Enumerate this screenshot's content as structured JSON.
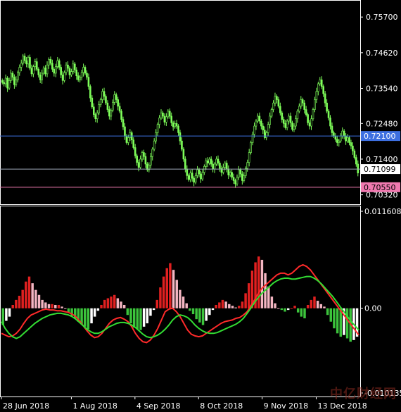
{
  "chart_data": [
    {
      "type": "candlestick",
      "panel": "price",
      "y_ticks": [
        "0.75700",
        "0.74620",
        "0.73540",
        "0.72480",
        "0.71400",
        "0.70320"
      ],
      "ylim": [
        0.7012,
        0.7596
      ],
      "closes": [
        0.7372,
        0.7368,
        0.7385,
        0.7355,
        0.7378,
        0.74,
        0.7388,
        0.7365,
        0.738,
        0.7402,
        0.7418,
        0.743,
        0.7452,
        0.7438,
        0.7428,
        0.7448,
        0.7415,
        0.7398,
        0.742,
        0.7435,
        0.7412,
        0.7395,
        0.738,
        0.74,
        0.7416,
        0.7398,
        0.7425,
        0.7442,
        0.743,
        0.7412,
        0.74,
        0.742,
        0.7438,
        0.7418,
        0.7395,
        0.7378,
        0.7402,
        0.7425,
        0.7415,
        0.7395,
        0.7405,
        0.7428,
        0.741,
        0.7392,
        0.738,
        0.7388,
        0.7402,
        0.7418,
        0.74,
        0.7388,
        0.736,
        0.7325,
        0.7298,
        0.7275,
        0.7262,
        0.728,
        0.7305,
        0.732,
        0.7345,
        0.733,
        0.731,
        0.729,
        0.727,
        0.7288,
        0.7312,
        0.7335,
        0.732,
        0.73,
        0.7285,
        0.726,
        0.7238,
        0.721,
        0.719,
        0.7205,
        0.722,
        0.7198,
        0.7175,
        0.715,
        0.713,
        0.7115,
        0.714,
        0.716,
        0.7148,
        0.7125,
        0.7108,
        0.7122,
        0.7148,
        0.717,
        0.7195,
        0.722,
        0.7245,
        0.7265,
        0.728,
        0.727,
        0.7252,
        0.7268,
        0.7285,
        0.727,
        0.725,
        0.7238,
        0.7248,
        0.724,
        0.722,
        0.7195,
        0.717,
        0.714,
        0.711,
        0.709,
        0.7078,
        0.7098,
        0.7082,
        0.707,
        0.709,
        0.7108,
        0.7095,
        0.708,
        0.71,
        0.7118,
        0.7135,
        0.7128,
        0.714,
        0.7125,
        0.711,
        0.7125,
        0.714,
        0.7128,
        0.7112,
        0.71,
        0.7115,
        0.7128,
        0.711,
        0.7092,
        0.71,
        0.7085,
        0.7075,
        0.7065,
        0.7085,
        0.7108,
        0.7095,
        0.7075,
        0.709,
        0.7112,
        0.713,
        0.716,
        0.719,
        0.7215,
        0.724,
        0.7255,
        0.727,
        0.7255,
        0.724,
        0.7228,
        0.7205,
        0.722,
        0.7245,
        0.727,
        0.729,
        0.731,
        0.733,
        0.732,
        0.73,
        0.728,
        0.726,
        0.7248,
        0.7235,
        0.7255,
        0.727,
        0.725,
        0.723,
        0.724,
        0.7262,
        0.7285,
        0.73,
        0.732,
        0.731,
        0.729,
        0.7275,
        0.725,
        0.724,
        0.7262,
        0.729,
        0.732,
        0.7345,
        0.7368,
        0.738,
        0.736,
        0.7338,
        0.731,
        0.7285,
        0.7265,
        0.724,
        0.722,
        0.721,
        0.72,
        0.719,
        0.7195,
        0.721,
        0.7225,
        0.721,
        0.7195,
        0.7205,
        0.719,
        0.718,
        0.7165,
        0.7145,
        0.7125,
        0.7098
      ],
      "horizontal_levels": [
        {
          "label": "0.72100",
          "value": 0.721,
          "color": "#3d6fe0",
          "label_bg": "#3d6fe0",
          "label_color": "#ffffff"
        },
        {
          "label": "0.71099",
          "value": 0.71099,
          "color": "#9ea8b8",
          "label_bg": "#ffffff",
          "label_color": "#000000"
        },
        {
          "label": "0.70550",
          "value": 0.7055,
          "color": "#f07ab0",
          "label_bg": "#f07ab0",
          "label_color": "#000000"
        }
      ],
      "colors": {
        "candle": "#7fff5a",
        "grid": "#ffffff"
      }
    },
    {
      "type": "macd",
      "panel": "indicator",
      "y_ticks": [
        "0.011608",
        "0.00",
        "-0.010135"
      ],
      "ylim": [
        -0.010135,
        0.011608
      ],
      "histogram": [
        -0.002,
        -0.0015,
        -0.001,
        0.0004,
        0.001,
        0.0015,
        0.0022,
        0.0032,
        0.0038,
        0.003,
        0.0022,
        0.0016,
        0.001,
        0.0007,
        0.0005,
        0.0005,
        0.0004,
        0.0004,
        0.0002,
        0.0,
        -0.0005,
        -0.0009,
        -0.0012,
        -0.0016,
        -0.0019,
        -0.0022,
        -0.0025,
        -0.0018,
        -0.001,
        -0.0003,
        0.0004,
        0.001,
        0.0012,
        0.0014,
        0.0016,
        0.0012,
        0.0008,
        0.0004,
        -0.0008,
        -0.0018,
        -0.0023,
        -0.0025,
        -0.0026,
        -0.0022,
        -0.0018,
        -0.0009,
        -0.0002,
        0.001,
        0.0025,
        0.0038,
        0.0048,
        0.0054,
        0.0046,
        0.0034,
        0.0022,
        0.0014,
        0.0006,
        -0.0003,
        -0.0007,
        -0.0013,
        -0.0017,
        -0.002,
        -0.0015,
        -0.0008,
        -0.0002,
        0.0004,
        0.0007,
        0.001,
        0.0008,
        0.0005,
        0.0003,
        0.0001,
        0.0003,
        0.0008,
        0.0018,
        0.003,
        0.0045,
        0.0055,
        0.0062,
        0.0058,
        0.0042,
        0.0026,
        0.0014,
        0.0006,
        0.0,
        -0.0002,
        -0.0004,
        -0.0002,
        0.0,
        0.0003,
        -0.0005,
        -0.001,
        -0.0012,
        0.0004,
        0.001,
        0.0014,
        0.0009,
        0.0005,
        0.0002,
        -0.0008,
        -0.0016,
        -0.0024,
        -0.003,
        -0.0034,
        -0.0032,
        -0.0036,
        -0.004,
        -0.0038,
        -0.0034
      ],
      "macd_line": [
        -0.003,
        -0.0032,
        -0.0034,
        -0.0033,
        -0.003,
        -0.0025,
        -0.0018,
        -0.0012,
        -0.0008,
        -0.0006,
        -0.0004,
        -0.0002,
        -0.0001,
        -0.0002,
        -0.0002,
        -0.0003,
        -0.0003,
        -0.0004,
        -0.0005,
        -0.0007,
        -0.001,
        -0.0015,
        -0.0021,
        -0.0027,
        -0.0032,
        -0.0035,
        -0.0034,
        -0.003,
        -0.0024,
        -0.0018,
        -0.0014,
        -0.0012,
        -0.0011,
        -0.0013,
        -0.0016,
        -0.0022,
        -0.003,
        -0.0036,
        -0.004,
        -0.0041,
        -0.0038,
        -0.0032,
        -0.0024,
        -0.0014,
        -0.0004,
        -0.0001,
        0.0,
        -0.0004,
        -0.001,
        -0.0018,
        -0.0026,
        -0.0031,
        -0.0033,
        -0.0034,
        -0.0033,
        -0.003,
        -0.0027,
        -0.0024,
        -0.0021,
        -0.0018,
        -0.0016,
        -0.0015,
        -0.0014,
        -0.0012,
        -0.0011,
        -0.0008,
        -0.0004,
        0.0003,
        0.001,
        0.0018,
        0.0024,
        0.0028,
        0.0032,
        0.0036,
        0.004,
        0.0042,
        0.0042,
        0.004,
        0.0042,
        0.0046,
        0.005,
        0.0052,
        0.005,
        0.0046,
        0.004,
        0.0034,
        0.0028,
        0.0022,
        0.0016,
        0.001,
        0.0004,
        -0.0002,
        -0.0008,
        -0.0014,
        -0.002,
        -0.0026,
        -0.0032
      ],
      "signal_line": [
        -0.0016,
        -0.0024,
        -0.003,
        -0.0034,
        -0.0036,
        -0.0034,
        -0.003,
        -0.0026,
        -0.0022,
        -0.0018,
        -0.0015,
        -0.0012,
        -0.001,
        -0.0008,
        -0.0007,
        -0.0006,
        -0.0006,
        -0.0007,
        -0.0008,
        -0.001,
        -0.0013,
        -0.0017,
        -0.0021,
        -0.0025,
        -0.0028,
        -0.003,
        -0.003,
        -0.0028,
        -0.0025,
        -0.0022,
        -0.002,
        -0.0018,
        -0.0017,
        -0.0017,
        -0.0018,
        -0.002,
        -0.0023,
        -0.0027,
        -0.0031,
        -0.0034,
        -0.0035,
        -0.0034,
        -0.0032,
        -0.0029,
        -0.0025,
        -0.002,
        -0.0014,
        -0.001,
        -0.0008,
        -0.0009,
        -0.0011,
        -0.0015,
        -0.002,
        -0.0024,
        -0.0027,
        -0.0029,
        -0.003,
        -0.003,
        -0.0029,
        -0.0027,
        -0.0025,
        -0.0023,
        -0.0021,
        -0.0019,
        -0.0016,
        -0.0012,
        -0.0006,
        0.0,
        0.0007,
        0.0013,
        0.0018,
        0.0022,
        0.0026,
        0.003,
        0.0033,
        0.0035,
        0.0036,
        0.0036,
        0.0035,
        0.0035,
        0.0036,
        0.0037,
        0.0038,
        0.0038,
        0.0036,
        0.0033,
        0.0029,
        0.0024,
        0.0019,
        0.0014,
        0.0008,
        0.0002,
        -0.0004,
        -0.001,
        -0.0016,
        -0.0021,
        -0.0026
      ],
      "colors": {
        "hist_up_strong": "#e02020",
        "hist_up_weak": "#f4b6c2",
        "hist_down_strong": "#3cc43c",
        "hist_down_weak": "#ffffff",
        "macd": "#ff2a2a",
        "signal": "#33dd33"
      }
    }
  ],
  "x_axis": {
    "labels": [
      "28 Jun 2018",
      "1 Aug 2018",
      "4 Sep 2018",
      "8 Oct 2018",
      "9 Nov 2018",
      "13 Dec 2018"
    ],
    "label_positions": [
      0.0,
      0.22,
      0.42,
      0.62,
      0.82,
      0.99
    ]
  },
  "watermark": "中亿财经网"
}
